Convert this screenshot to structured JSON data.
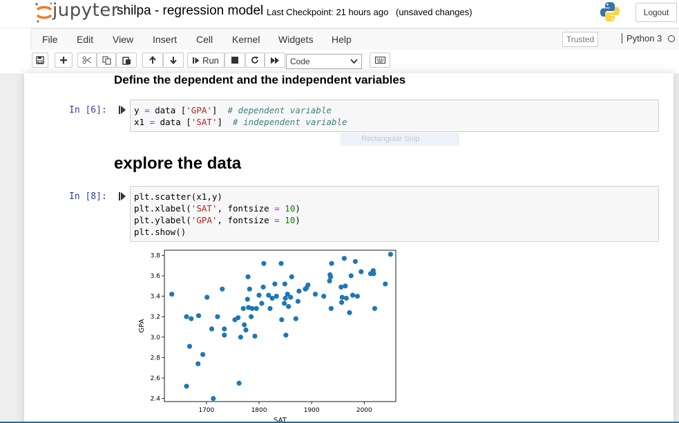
{
  "header": {
    "logo_text": "jupyter",
    "notebook_title": "shilpa - regression model",
    "checkpoint": "Last Checkpoint: 21 hours ago",
    "status": "(unsaved changes)",
    "logout_label": "Logout"
  },
  "menubar": {
    "items": [
      "File",
      "Edit",
      "View",
      "Insert",
      "Cell",
      "Kernel",
      "Widgets",
      "Help"
    ],
    "trusted_label": "Trusted",
    "kernel_name": "Python 3"
  },
  "toolbar": {
    "run_label": "Run",
    "cell_type": "Code"
  },
  "cells": {
    "heading1": "Define the dependent and the independent variables",
    "cell1_prompt": "In [6]:",
    "heading2": "explore the data",
    "cell2_prompt": "In [8]:",
    "tooltip_ghost": "Rectangular Snip"
  },
  "chart_data": {
    "type": "scatter",
    "xlabel": "SAT",
    "ylabel": "GPA",
    "xlim": [
      1620,
      2060
    ],
    "ylim": [
      2.37,
      3.85
    ],
    "xticks": [
      1700,
      1800,
      1900,
      2000
    ],
    "yticks": [
      2.4,
      2.6,
      2.8,
      3.0,
      3.2,
      3.4,
      3.6,
      3.8
    ],
    "color": "#1f77b4",
    "points": [
      [
        1634,
        3.42
      ],
      [
        1662,
        3.2
      ],
      [
        1662,
        2.52
      ],
      [
        1668,
        2.91
      ],
      [
        1671,
        3.18
      ],
      [
        1684,
        2.74
      ],
      [
        1685,
        3.21
      ],
      [
        1693,
        2.83
      ],
      [
        1701,
        3.39
      ],
      [
        1710,
        3.08
      ],
      [
        1713,
        2.4
      ],
      [
        1721,
        3.2
      ],
      [
        1730,
        3.47
      ],
      [
        1734,
        3.02
      ],
      [
        1734,
        3.08
      ],
      [
        1754,
        3.17
      ],
      [
        1760,
        3.19
      ],
      [
        1762,
        2.55
      ],
      [
        1765,
        3.0
      ],
      [
        1770,
        3.28
      ],
      [
        1772,
        3.12
      ],
      [
        1775,
        3.07
      ],
      [
        1778,
        3.37
      ],
      [
        1779,
        3.59
      ],
      [
        1780,
        3.29
      ],
      [
        1782,
        3.47
      ],
      [
        1785,
        3.2
      ],
      [
        1787,
        3.28
      ],
      [
        1792,
        3.01
      ],
      [
        1795,
        3.28
      ],
      [
        1800,
        3.41
      ],
      [
        1805,
        3.33
      ],
      [
        1808,
        3.49
      ],
      [
        1809,
        3.72
      ],
      [
        1818,
        3.41
      ],
      [
        1821,
        3.28
      ],
      [
        1825,
        3.38
      ],
      [
        1830,
        3.52
      ],
      [
        1833,
        3.4
      ],
      [
        1842,
        3.72
      ],
      [
        1843,
        3.17
      ],
      [
        1848,
        3.33
      ],
      [
        1849,
        3.52
      ],
      [
        1850,
        3.38
      ],
      [
        1851,
        3.02
      ],
      [
        1854,
        3.42
      ],
      [
        1856,
        3.3
      ],
      [
        1860,
        3.39
      ],
      [
        1862,
        3.59
      ],
      [
        1870,
        3.18
      ],
      [
        1874,
        3.35
      ],
      [
        1876,
        3.45
      ],
      [
        1888,
        3.47
      ],
      [
        1890,
        3.48
      ],
      [
        1893,
        3.51
      ],
      [
        1907,
        3.42
      ],
      [
        1923,
        3.4
      ],
      [
        1934,
        3.55
      ],
      [
        1935,
        3.61
      ],
      [
        1936,
        3.59
      ],
      [
        1937,
        3.28
      ],
      [
        1938,
        3.72
      ],
      [
        1956,
        3.49
      ],
      [
        1957,
        3.34
      ],
      [
        1958,
        3.39
      ],
      [
        1962,
        3.77
      ],
      [
        1964,
        3.5
      ],
      [
        1966,
        3.38
      ],
      [
        1972,
        3.24
      ],
      [
        1975,
        3.6
      ],
      [
        1978,
        3.41
      ],
      [
        1983,
        3.74
      ],
      [
        1987,
        3.4
      ],
      [
        1994,
        3.64
      ],
      [
        2012,
        3.62
      ],
      [
        2017,
        3.65
      ],
      [
        2018,
        3.62
      ],
      [
        2020,
        3.28
      ],
      [
        2040,
        3.52
      ],
      [
        2050,
        3.81
      ]
    ]
  }
}
